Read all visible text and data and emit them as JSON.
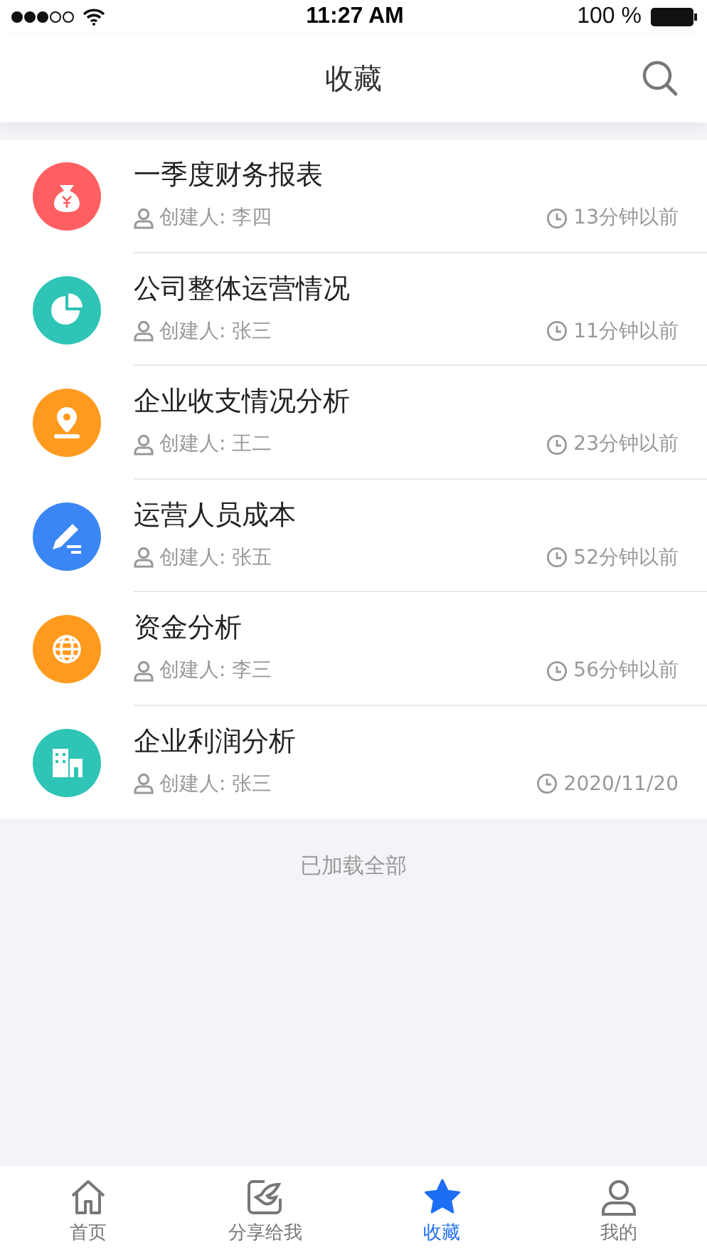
{
  "status_bar": {
    "time": "11:27 AM",
    "battery": "100 %"
  },
  "header": {
    "title": "收藏"
  },
  "items": [
    {
      "title": "一季度财务报表",
      "creator": "创建人: 李四",
      "time": "13分钟以前",
      "kind": "money",
      "color": "#ff5f63"
    },
    {
      "title": "公司整体运营情况",
      "creator": "创建人: 张三",
      "time": "11分钟以前",
      "kind": "pie",
      "color": "#2ec4b6"
    },
    {
      "title": "企业收支情况分析",
      "creator": "创建人: 王二",
      "time": "23分钟以前",
      "kind": "pin",
      "color": "#ff9a1f"
    },
    {
      "title": "运营人员成本",
      "creator": "创建人: 张五",
      "time": "52分钟以前",
      "kind": "pencil",
      "color": "#3a86f5"
    },
    {
      "title": "资金分析",
      "creator": "创建人: 李三",
      "time": "56分钟以前",
      "kind": "globe",
      "color": "#ff9a1f"
    },
    {
      "title": "企业利润分析",
      "creator": "创建人: 张三",
      "time": "2020/11/20",
      "kind": "building",
      "color": "#2ec4b6"
    }
  ],
  "footer": "已加载全部",
  "tabs": [
    {
      "label": "首页",
      "kind": "home",
      "selected": false
    },
    {
      "label": "分享给我",
      "kind": "share",
      "selected": false
    },
    {
      "label": "收藏",
      "kind": "star",
      "selected": true
    },
    {
      "label": "我的",
      "kind": "user",
      "selected": false
    }
  ]
}
